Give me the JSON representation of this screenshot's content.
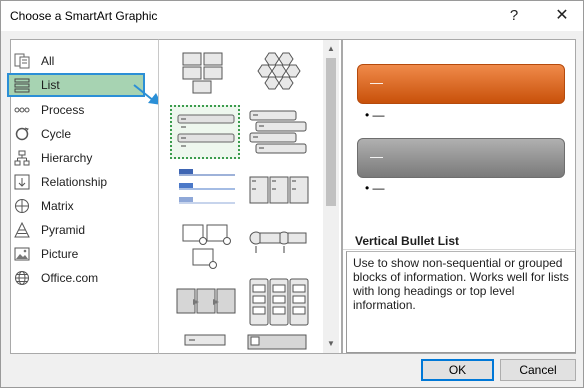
{
  "window": {
    "title": "Choose a SmartArt Graphic",
    "help_glyph": "?",
    "close_glyph": "✕"
  },
  "categories": [
    {
      "label": "All",
      "icon": "all-icon"
    },
    {
      "label": "List",
      "icon": "list-icon",
      "selected": true
    },
    {
      "label": "Process",
      "icon": "process-icon"
    },
    {
      "label": "Cycle",
      "icon": "cycle-icon"
    },
    {
      "label": "Hierarchy",
      "icon": "hierarchy-icon"
    },
    {
      "label": "Relationship",
      "icon": "relationship-icon"
    },
    {
      "label": "Matrix",
      "icon": "matrix-icon"
    },
    {
      "label": "Pyramid",
      "icon": "pyramid-icon"
    },
    {
      "label": "Picture",
      "icon": "picture-icon"
    },
    {
      "label": "Office.com",
      "icon": "globe-icon"
    }
  ],
  "preview": {
    "orange_text": "—",
    "orange_bullet": "• —",
    "gray_text": "—",
    "gray_bullet": "• —",
    "colors": {
      "orange": "#e0691f",
      "gray": "#8c8c8c"
    }
  },
  "description": {
    "title": "Vertical Bullet List",
    "text": "Use to show non-sequential or grouped blocks of information. Works well for lists with long headings or top level information."
  },
  "buttons": {
    "ok": "OK",
    "cancel": "Cancel"
  },
  "accent": {
    "selection": "#2b8fd6",
    "selected_fill": "#a7d3b2"
  }
}
